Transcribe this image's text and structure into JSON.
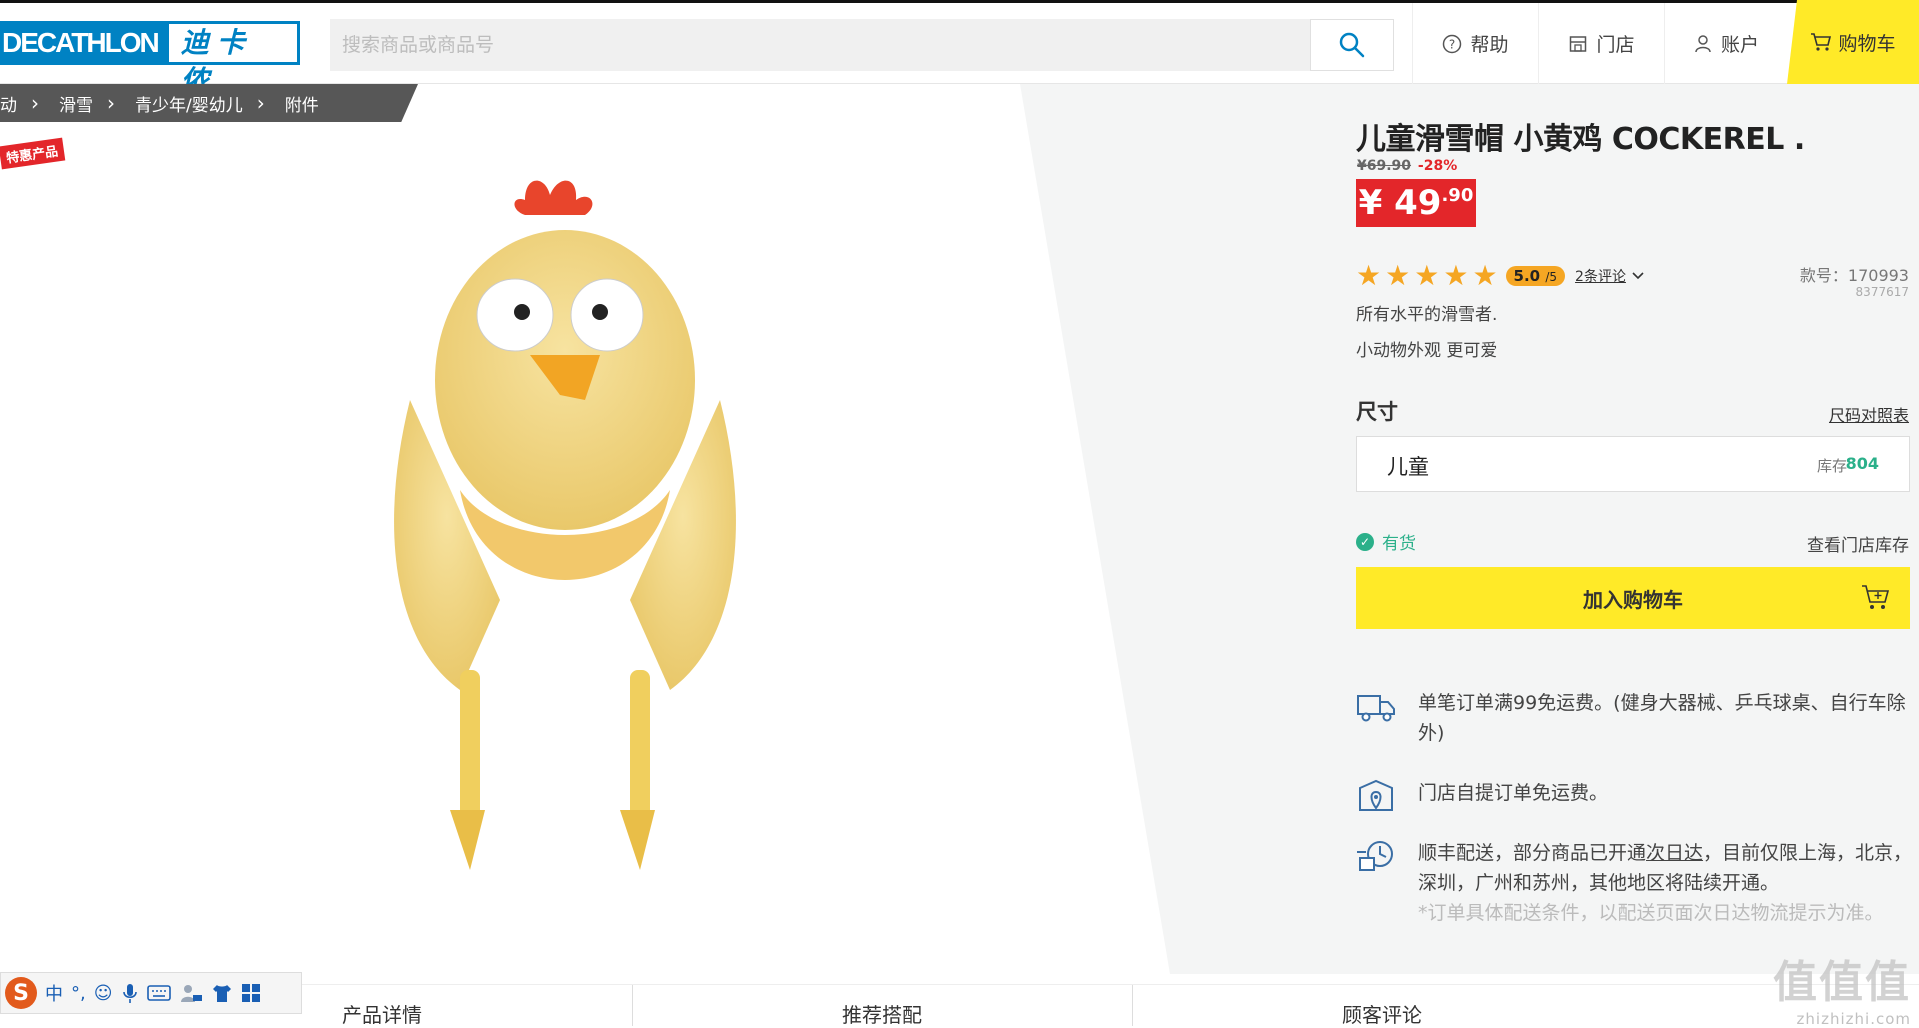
{
  "header": {
    "logo_en": "DECATHLON",
    "logo_cn": "迪卡侬",
    "search_placeholder": "搜索商品或商品号",
    "nav": [
      {
        "label": "帮助",
        "icon": "help-icon"
      },
      {
        "label": "门店",
        "icon": "store-icon"
      },
      {
        "label": "账户",
        "icon": "user-icon"
      }
    ],
    "cart_label": "购物车",
    "cart_color": "#ffea28"
  },
  "breadcrumb": [
    "动",
    "滑雪",
    "青少年/婴幼儿",
    "附件"
  ],
  "badge": "特惠产品",
  "product": {
    "title": "儿童滑雪帽 小黄鸡 COCKEREL .",
    "old_price": "¥69.90",
    "discount": "-28%",
    "price_main": "¥ 49",
    "price_decimal": ".90",
    "rating_value": "5.0",
    "rating_max": "/5",
    "stars": 5,
    "reviews": "2条评论",
    "model_no": "款号：170993",
    "model_sub": "8377617",
    "desc1": "所有水平的滑雪者.",
    "desc2": "小动物外观 更可爱",
    "size_label": "尺寸",
    "size_chart": "尺码对照表",
    "size_value": "儿童",
    "stock_label": "库存",
    "stock_value": "804",
    "availability": "有货",
    "store_stock": "查看门店库存",
    "add_to_cart": "加入购物车",
    "price_color": "#e3262a",
    "available_color": "#2bb08a"
  },
  "shipping": [
    {
      "icon": "truck-icon",
      "text": "单笔订单满99免运费。(健身大器械、乒乓球桌、自行车除外)"
    },
    {
      "icon": "store-pickup-icon",
      "text": "门店自提订单免运费。"
    },
    {
      "icon": "express-delivery-icon",
      "text_before": "顺丰配送，部分商品已开通",
      "link": "次日达",
      "text_after": "，目前仅限上海，北京，深圳，广州和苏州，其他地区将陆续开通。",
      "note": "*订单具体配送条件，以配送页面次日达物流提示为准。"
    }
  ],
  "ime_bar": {
    "lang": "中",
    "punct": "°,"
  },
  "tabs": [
    "产品详情",
    "推荐搭配",
    "顾客评论"
  ],
  "watermark": {
    "big": "值值值",
    "small": "zhizhizhi.com"
  }
}
